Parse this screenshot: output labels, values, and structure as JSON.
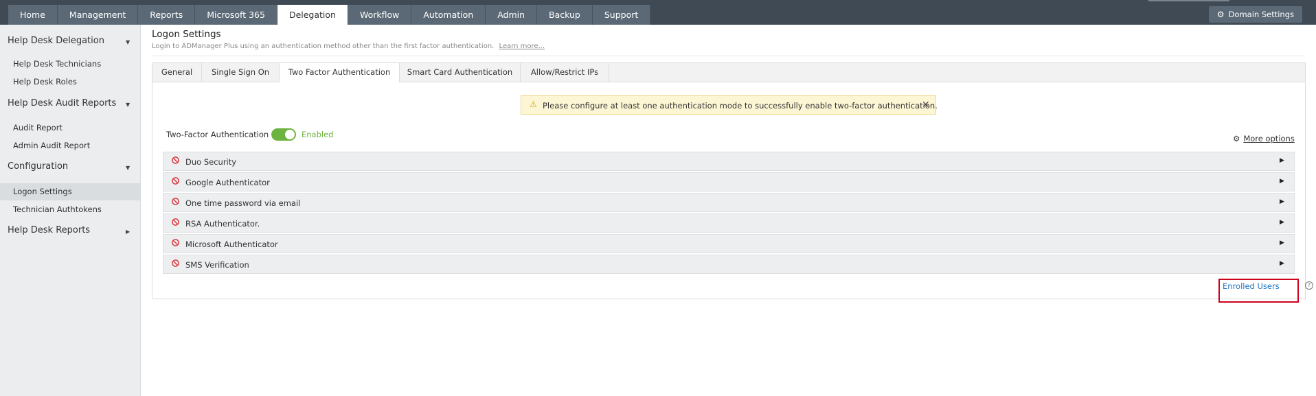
{
  "nav": {
    "tabs": [
      "Home",
      "Management",
      "Reports",
      "Microsoft 365",
      "Delegation",
      "Workflow",
      "Automation",
      "Admin",
      "Backup",
      "Support"
    ],
    "active_tab": "Delegation",
    "domain_settings": "Domain Settings"
  },
  "sidebar": {
    "sections": [
      {
        "label": "Help Desk Delegation",
        "items": [
          "Help Desk Technicians",
          "Help Desk Roles"
        ]
      },
      {
        "label": "Help Desk Audit Reports",
        "items": [
          "Audit Report",
          "Admin Audit Report"
        ]
      },
      {
        "label": "Configuration",
        "items": [
          "Logon Settings",
          "Technician Authtokens"
        ]
      },
      {
        "label": "Help Desk Reports",
        "items": []
      }
    ],
    "active_item": "Logon Settings"
  },
  "page": {
    "title": "Logon Settings",
    "subtitle": "Login to ADManager Plus using an authentication method other than the first factor authentication.",
    "learn_more": "Learn more..."
  },
  "subtabs": [
    "General",
    "Single Sign On",
    "Two Factor Authentication",
    "Smart Card Authentication",
    "Allow/Restrict IPs"
  ],
  "active_subtab": "Two Factor Authentication",
  "alert": {
    "message": "Please configure at least one authentication mode to successfully enable two-factor authentication."
  },
  "two_factor": {
    "label": "Two-Factor Authentication",
    "state": "Enabled",
    "enabled": true,
    "more_options": "More options",
    "methods": [
      "Duo Security",
      "Google Authenticator",
      "One time password via email",
      "RSA Authenticator.",
      "Microsoft Authenticator",
      "SMS Verification"
    ],
    "enrolled_users": "Enrolled Users"
  },
  "colors": {
    "topbar": "#3f4a55",
    "tab": "#5b6976",
    "toggle_on": "#6db33f",
    "link": "#1a73c4",
    "alert_bg": "#fdf6d5",
    "highlight_border": "#d0021b",
    "ban_icon": "#d9373f"
  }
}
